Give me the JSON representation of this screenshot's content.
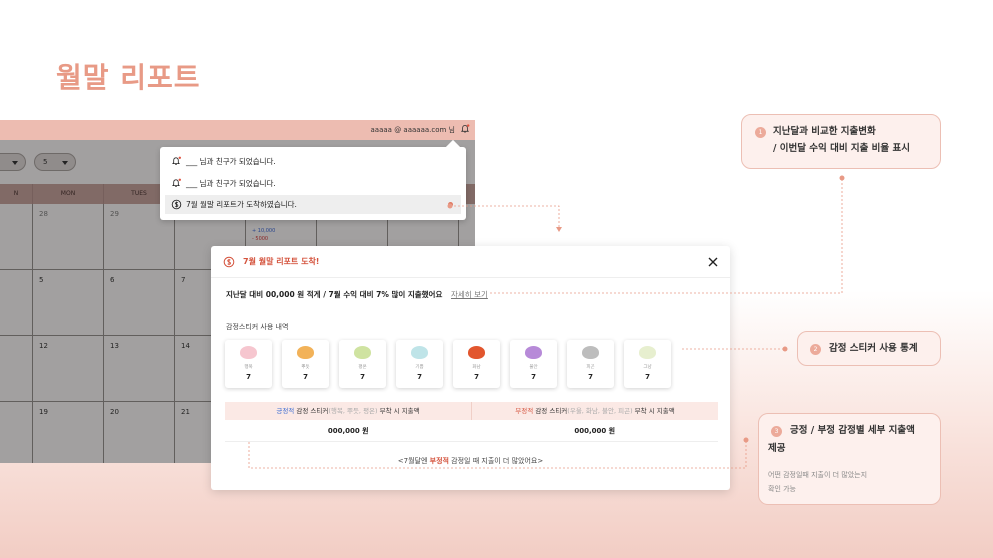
{
  "page": {
    "heading": "월말 리포트"
  },
  "app": {
    "account": "aaaaa @ aaaaaa.com 님",
    "selects": [
      {
        "value": ""
      },
      {
        "value": "5"
      }
    ],
    "weekdays": [
      "N",
      "MON",
      "TUES",
      "",
      "",
      "",
      ""
    ],
    "rows": [
      {
        "cells": [
          "",
          "28",
          "29",
          "",
          "",
          "",
          ""
        ],
        "money_plus": "+ 10,000",
        "money_minus": "- 5000"
      },
      {
        "cells": [
          "",
          "5",
          "6",
          "7",
          "",
          "",
          ""
        ]
      },
      {
        "cells": [
          "",
          "12",
          "13",
          "14",
          "",
          "",
          ""
        ]
      },
      {
        "cells": [
          "",
          "19",
          "20",
          "21",
          "",
          "",
          ""
        ]
      }
    ]
  },
  "notifications": [
    {
      "text": "___ 님과 친구가 되었습니다.",
      "icon": "bell-icon",
      "active": false
    },
    {
      "text": "___ 님과 친구가 되었습니다.",
      "icon": "bell-icon",
      "active": false
    },
    {
      "text": "7월 월말 리포트가 도착하였습니다.",
      "icon": "coin-icon",
      "active": true
    }
  ],
  "modal": {
    "title": "7월 월말 리포트 도착!",
    "summary": "지난달 대비 00,000 원 적게 / 7월 수익 대비 7% 많이 지출했어요",
    "detail_link": "자세히 보기",
    "sticker_section_label": "감정스티커 사용 내역",
    "stickers": [
      {
        "name": "행복",
        "count": "7",
        "color": "#f6c6cf"
      },
      {
        "name": "뿌듯",
        "count": "7",
        "color": "#f2b259"
      },
      {
        "name": "평온",
        "count": "7",
        "color": "#cfe3a1"
      },
      {
        "name": "기쁨",
        "count": "7",
        "color": "#bfe4e8"
      },
      {
        "name": "화남",
        "count": "7",
        "color": "#e2562e"
      },
      {
        "name": "불안",
        "count": "7",
        "color": "#b78ad8"
      },
      {
        "name": "피곤",
        "count": "7",
        "color": "#bdbdbd"
      },
      {
        "name": "그냥",
        "count": "7",
        "color": "#e7efcf"
      }
    ],
    "positive": {
      "word": "긍정적",
      "label_mid": " 감정 스티커",
      "examples": "(행복, 뿌듯, 평온)",
      "label_end": " 부착 시 지출액",
      "amount": "000,000 원"
    },
    "negative": {
      "word": "부정적",
      "label_mid": " 감정 스티커",
      "examples": "(우울, 화남, 불안, 피곤)",
      "label_end": " 부착 시 지출액",
      "amount": "000,000 원"
    },
    "conclusion_pre": "<7월달엔 ",
    "conclusion_word": "부정적",
    "conclusion_post": " 감정일 때 지출이 더 많았어요>"
  },
  "callouts": [
    {
      "num": "1",
      "title_line1": "지난달과 비교한 지출변화",
      "title_line2": "/ 이번달 수익 대비 지출 비율 표시"
    },
    {
      "num": "2",
      "title_line1": "감정 스티커 사용 통계"
    },
    {
      "num": "3",
      "title_line1": "긍정 / 부정 감정별 세부 지출액",
      "title_line2": "제공",
      "sub_line1": "어떤 감정일때 지출이 더 많았는지",
      "sub_line2": "확인 가능"
    }
  ],
  "colors": {
    "accent": "#e89a86",
    "negative": "#d4533d",
    "positive": "#3c6dd2",
    "callout_bg": "#fdf0ed"
  }
}
